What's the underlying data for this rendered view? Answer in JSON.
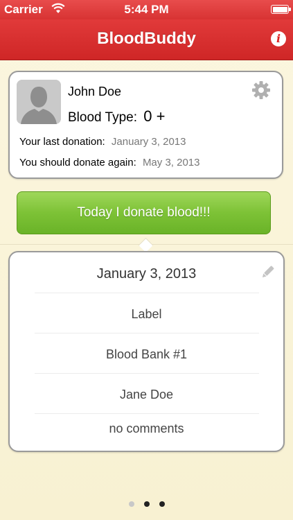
{
  "status_bar": {
    "carrier": "Carrier",
    "time": "5:44 PM"
  },
  "nav": {
    "title": "BloodBuddy",
    "info_icon": "info-icon"
  },
  "profile": {
    "name": "John Doe",
    "blood_type_label": "Blood Type:",
    "blood_type_value": "0 +",
    "last_donation_label": "Your last donation:",
    "last_donation_value": "January 3, 2013",
    "next_donation_label": "You should donate again:",
    "next_donation_value": "May 3, 2013",
    "settings_icon": "gear-icon"
  },
  "donate_button": {
    "label": "Today I donate blood!!!"
  },
  "donation_details": {
    "date": "January 3, 2013",
    "label": "Label",
    "blood_bank": "Blood Bank #1",
    "staff": "Jane Doe",
    "comments": "no comments",
    "edit_icon": "pencil-icon"
  },
  "pager": {
    "count": 3,
    "active_index": 1
  },
  "colors": {
    "nav_red": "#d83030",
    "button_green": "#7dc236",
    "background": "#fbf6df"
  }
}
